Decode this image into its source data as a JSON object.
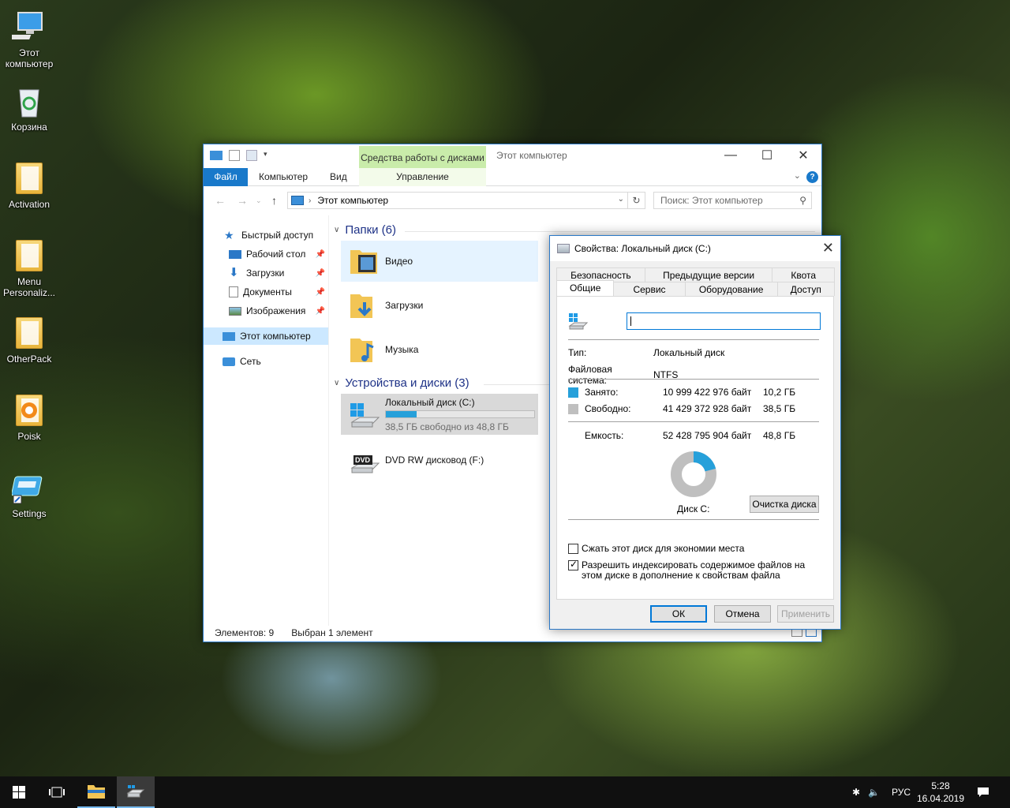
{
  "desktop": {
    "icons": [
      {
        "label": "Этот компьютер"
      },
      {
        "label": "Корзина"
      },
      {
        "label": "Activation"
      },
      {
        "label": "Menu Personaliz..."
      },
      {
        "label": "OtherPack"
      },
      {
        "label": "Poisk"
      },
      {
        "label": "Settings"
      }
    ]
  },
  "explorer": {
    "title": "Этот компьютер",
    "tool_tab": "Средства работы с дисками",
    "ribbon_tabs": {
      "file": "Файл",
      "computer": "Компьютер",
      "view": "Вид",
      "manage": "Управление"
    },
    "address": "Этот компьютер",
    "search_placeholder": "Поиск: Этот компьютер",
    "nav": {
      "quick_access": "Быстрый доступ",
      "desktop": "Рабочий стол",
      "downloads": "Загрузки",
      "documents": "Документы",
      "pictures": "Изображения",
      "this_pc": "Этот компьютер",
      "network": "Сеть"
    },
    "folders_header": "Папки (6)",
    "folders": [
      {
        "label": "Видео"
      },
      {
        "label": "Загрузки"
      },
      {
        "label": "Музыка"
      }
    ],
    "devices_header": "Устройства и диски (3)",
    "drives": [
      {
        "label": "Локальный диск (C:)",
        "sub": "38,5 ГБ свободно из 48,8 ГБ",
        "used_fraction": 0.21
      },
      {
        "label": "DVD RW дисковод (F:)",
        "badge": "DVD"
      }
    ],
    "status": {
      "items": "Элементов: 9",
      "selected": "Выбран 1 элемент"
    }
  },
  "dialog": {
    "title": "Свойства: Локальный диск (C:)",
    "tabs_row1": [
      "Безопасность",
      "Предыдущие версии",
      "Квота"
    ],
    "tabs_row2": [
      "Общие",
      "Сервис",
      "Оборудование",
      "Доступ"
    ],
    "name_value": "",
    "type_label": "Тип:",
    "type_value": "Локальный диск",
    "fs_label": "Файловая система:",
    "fs_value": "NTFS",
    "used_label": "Занято:",
    "used_bytes": "10 999 422 976 байт",
    "used_gb": "10,2 ГБ",
    "free_label": "Свободно:",
    "free_bytes": "41 429 372 928 байт",
    "free_gb": "38,5 ГБ",
    "capacity_label": "Емкость:",
    "capacity_bytes": "52 428 795 904 байт",
    "capacity_gb": "48,8 ГБ",
    "disk_label": "Диск C:",
    "cleanup_button": "Очистка диска",
    "compress_label": "Сжать этот диск для экономии места",
    "compress_checked": false,
    "index_label": "Разрешить индексировать содержимое файлов на этом диске в дополнение к свойствам файла",
    "index_checked": true,
    "ok": "ОК",
    "cancel": "Отмена",
    "apply": "Применить",
    "used_fraction": 0.21,
    "colors": {
      "used": "#26a0da",
      "free": "#bfbfbf"
    }
  },
  "taskbar": {
    "lang": "РУС",
    "time": "5:28",
    "date": "16.04.2019"
  }
}
